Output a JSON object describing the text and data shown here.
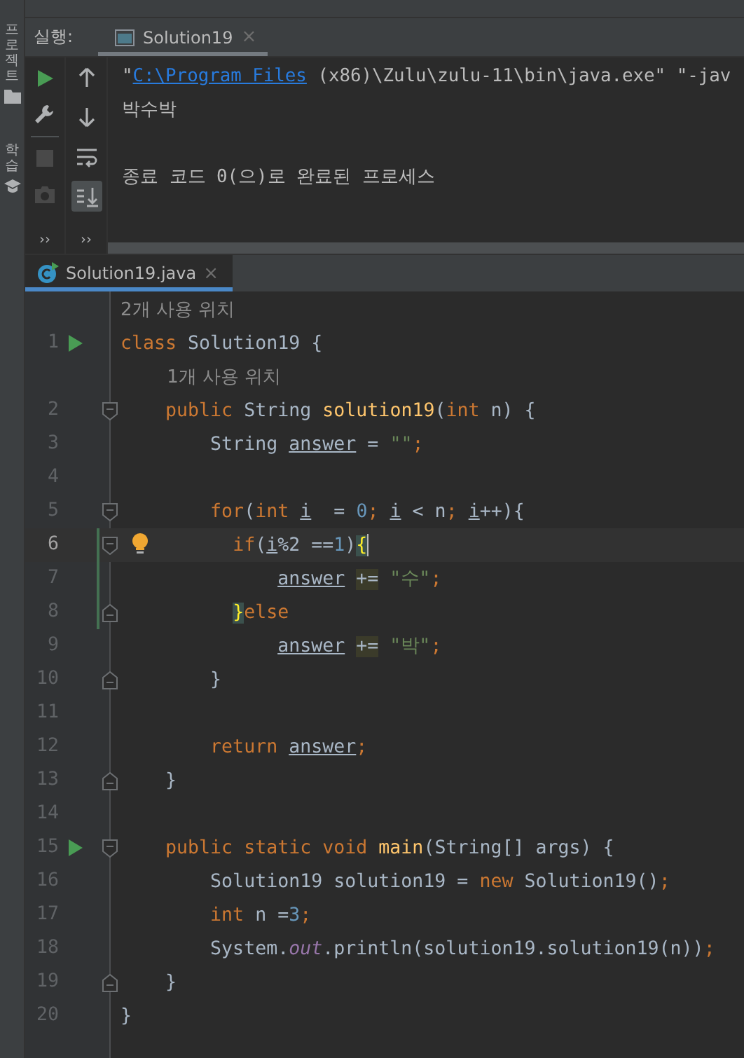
{
  "side_tabs": [
    {
      "label": "프로젝트"
    },
    {
      "label": "학습"
    }
  ],
  "run_panel": {
    "label": "실행:",
    "tab": {
      "title": "Solution19",
      "close": "×",
      "selected": true
    },
    "toolbar_left": [
      {
        "kind": "run",
        "disabled": false
      },
      {
        "kind": "wrench",
        "disabled": false
      },
      {
        "kind": "stop",
        "disabled": true
      },
      {
        "kind": "camera",
        "disabled": true
      }
    ],
    "toolbar_right": [
      {
        "kind": "up",
        "on": false
      },
      {
        "kind": "down",
        "on": false
      },
      {
        "kind": "wrap",
        "on": false
      },
      {
        "kind": "scroll-end",
        "on": true
      }
    ],
    "overflow": [
      "››",
      "››"
    ],
    "output": [
      {
        "gap_before": false,
        "parts": [
          {
            "text": "\"",
            "kind": "plain"
          },
          {
            "text": "C:\\Program Files",
            "kind": "link"
          },
          {
            "text": " (x86)\\Zulu\\zulu-11\\bin\\java.exe\" \"-jav",
            "kind": "plain"
          }
        ]
      },
      {
        "gap_before": false,
        "parts": [
          {
            "text": "박수박",
            "kind": "plain"
          }
        ]
      },
      {
        "gap_before": true,
        "parts": [
          {
            "text": "종료 코드 0(으)로 완료된 프로세스",
            "kind": "plain"
          }
        ]
      }
    ]
  },
  "editor": {
    "tab": {
      "title": "Solution19.java",
      "close": "×",
      "selected": true
    },
    "lines": [
      {
        "kind": "hint",
        "text": "2개 사용 위치"
      },
      {
        "kind": "code",
        "number": "1",
        "run": true,
        "fold_start": false,
        "fold_end": false,
        "current": false,
        "bulb": false,
        "changed": false,
        "tokens": [
          {
            "text": "class",
            "kind": "kw"
          },
          {
            "text": " Solution19 {",
            "kind": "plain"
          }
        ]
      },
      {
        "kind": "hint",
        "text": "1개 사용 위치"
      },
      {
        "kind": "code",
        "number": "2",
        "run": false,
        "fold_start": true,
        "fold_end": false,
        "current": false,
        "bulb": false,
        "changed": false,
        "tokens": [
          {
            "text": "    public",
            "kind": "kw"
          },
          {
            "text": " String",
            "kind": "plain"
          },
          {
            "text": " solution19",
            "kind": "method"
          },
          {
            "text": "(",
            "kind": "plain"
          },
          {
            "text": "int",
            "kind": "kw"
          },
          {
            "text": " n) {",
            "kind": "plain"
          }
        ]
      },
      {
        "kind": "code",
        "number": "3",
        "run": false,
        "fold_start": false,
        "fold_end": false,
        "current": false,
        "bulb": false,
        "changed": false,
        "tokens": [
          {
            "text": "        String",
            "kind": "plain"
          },
          {
            "text": " answer",
            "kind": "var"
          },
          {
            "text": " =",
            "kind": "plain"
          },
          {
            "text": " \"\"",
            "kind": "str"
          },
          {
            "text": ";",
            "kind": "kw"
          }
        ]
      },
      {
        "kind": "code",
        "number": "4",
        "run": false,
        "fold_start": false,
        "fold_end": false,
        "current": false,
        "bulb": false,
        "changed": false
      },
      {
        "kind": "code",
        "number": "5",
        "run": false,
        "fold_start": true,
        "fold_end": false,
        "current": false,
        "bulb": false,
        "changed": false,
        "tokens": [
          {
            "text": "        for",
            "kind": "kw"
          },
          {
            "text": "(",
            "kind": "plain"
          },
          {
            "text": "int",
            "kind": "kw"
          },
          {
            "text": " i",
            "kind": "var"
          },
          {
            "text": "  =",
            "kind": "plain"
          },
          {
            "text": " 0",
            "kind": "num"
          },
          {
            "text": ";",
            "kind": "kw"
          },
          {
            "text": " i",
            "kind": "var"
          },
          {
            "text": " < n",
            "kind": "plain"
          },
          {
            "text": ";",
            "kind": "kw"
          },
          {
            "text": " i",
            "kind": "var"
          },
          {
            "text": "++){",
            "kind": "plain"
          }
        ]
      },
      {
        "kind": "code",
        "number": "6",
        "run": false,
        "fold_start": true,
        "fold_end": false,
        "current": true,
        "bulb": true,
        "changed": true,
        "tokens": [
          {
            "text": "          if",
            "kind": "kw"
          },
          {
            "text": "(",
            "kind": "plain"
          },
          {
            "text": "i",
            "kind": "var"
          },
          {
            "text": "%2 ==",
            "kind": "plain"
          },
          {
            "text": "1",
            "kind": "num"
          },
          {
            "text": ")",
            "kind": "plain"
          },
          {
            "text": "{",
            "kind": "brace"
          }
        ]
      },
      {
        "kind": "code",
        "number": "7",
        "run": false,
        "fold_start": false,
        "fold_end": false,
        "current": false,
        "bulb": false,
        "changed": true,
        "tokens": [
          {
            "text": "              answer",
            "kind": "var"
          },
          {
            "text": " +=",
            "kind": "op"
          },
          {
            "text": " \"수\"",
            "kind": "str"
          },
          {
            "text": ";",
            "kind": "kw"
          }
        ]
      },
      {
        "kind": "code",
        "number": "8",
        "run": false,
        "fold_start": false,
        "fold_end": true,
        "current": false,
        "bulb": false,
        "changed": true,
        "tokens": [
          {
            "text": "          }",
            "kind": "brace"
          },
          {
            "text": "else",
            "kind": "kw"
          }
        ]
      },
      {
        "kind": "code",
        "number": "9",
        "run": false,
        "fold_start": false,
        "fold_end": false,
        "current": false,
        "bulb": false,
        "changed": false,
        "tokens": [
          {
            "text": "              answer",
            "kind": "var"
          },
          {
            "text": " +=",
            "kind": "op"
          },
          {
            "text": " \"박\"",
            "kind": "str"
          },
          {
            "text": ";",
            "kind": "kw"
          }
        ]
      },
      {
        "kind": "code",
        "number": "10",
        "run": false,
        "fold_start": false,
        "fold_end": true,
        "current": false,
        "bulb": false,
        "changed": false,
        "tokens": [
          {
            "text": "        }",
            "kind": "plain"
          }
        ]
      },
      {
        "kind": "code",
        "number": "11",
        "run": false,
        "fold_start": false,
        "fold_end": false,
        "current": false,
        "bulb": false,
        "changed": false
      },
      {
        "kind": "code",
        "number": "12",
        "run": false,
        "fold_start": false,
        "fold_end": false,
        "current": false,
        "bulb": false,
        "changed": false,
        "tokens": [
          {
            "text": "        return",
            "kind": "kw"
          },
          {
            "text": " answer",
            "kind": "var"
          },
          {
            "text": ";",
            "kind": "kw"
          }
        ]
      },
      {
        "kind": "code",
        "number": "13",
        "run": false,
        "fold_start": false,
        "fold_end": true,
        "current": false,
        "bulb": false,
        "changed": false,
        "tokens": [
          {
            "text": "    }",
            "kind": "plain"
          }
        ]
      },
      {
        "kind": "code",
        "number": "14",
        "run": false,
        "fold_start": false,
        "fold_end": false,
        "current": false,
        "bulb": false,
        "changed": false
      },
      {
        "kind": "code",
        "number": "15",
        "run": true,
        "fold_start": true,
        "fold_end": false,
        "current": false,
        "bulb": false,
        "changed": false,
        "tokens": [
          {
            "text": "    public static void",
            "kind": "kw"
          },
          {
            "text": " main",
            "kind": "method"
          },
          {
            "text": "(String[] args) {",
            "kind": "plain"
          }
        ]
      },
      {
        "kind": "code",
        "number": "16",
        "run": false,
        "fold_start": false,
        "fold_end": false,
        "current": false,
        "bulb": false,
        "changed": false,
        "tokens": [
          {
            "text": "        Solution19 solution19 =",
            "kind": "plain"
          },
          {
            "text": " new",
            "kind": "kw"
          },
          {
            "text": " Solution19()",
            "kind": "plain"
          },
          {
            "text": ";",
            "kind": "kw"
          }
        ]
      },
      {
        "kind": "code",
        "number": "17",
        "run": false,
        "fold_start": false,
        "fold_end": false,
        "current": false,
        "bulb": false,
        "changed": false,
        "tokens": [
          {
            "text": "        int",
            "kind": "kw"
          },
          {
            "text": " n =",
            "kind": "plain"
          },
          {
            "text": "3",
            "kind": "num"
          },
          {
            "text": ";",
            "kind": "kw"
          }
        ]
      },
      {
        "kind": "code",
        "number": "18",
        "run": false,
        "fold_start": false,
        "fold_end": false,
        "current": false,
        "bulb": false,
        "changed": false,
        "tokens": [
          {
            "text": "        System.",
            "kind": "plain"
          },
          {
            "text": "out",
            "kind": "field"
          },
          {
            "text": ".println(solution19.solution19(n))",
            "kind": "plain"
          },
          {
            "text": ";",
            "kind": "kw"
          }
        ]
      },
      {
        "kind": "code",
        "number": "19",
        "run": false,
        "fold_start": false,
        "fold_end": true,
        "current": false,
        "bulb": false,
        "changed": false,
        "tokens": [
          {
            "text": "    }",
            "kind": "plain"
          }
        ]
      },
      {
        "kind": "code",
        "number": "20",
        "run": false,
        "fold_start": false,
        "fold_end": false,
        "current": false,
        "bulb": false,
        "changed": false,
        "tokens": [
          {
            "text": "}",
            "kind": "plain"
          }
        ]
      }
    ]
  }
}
